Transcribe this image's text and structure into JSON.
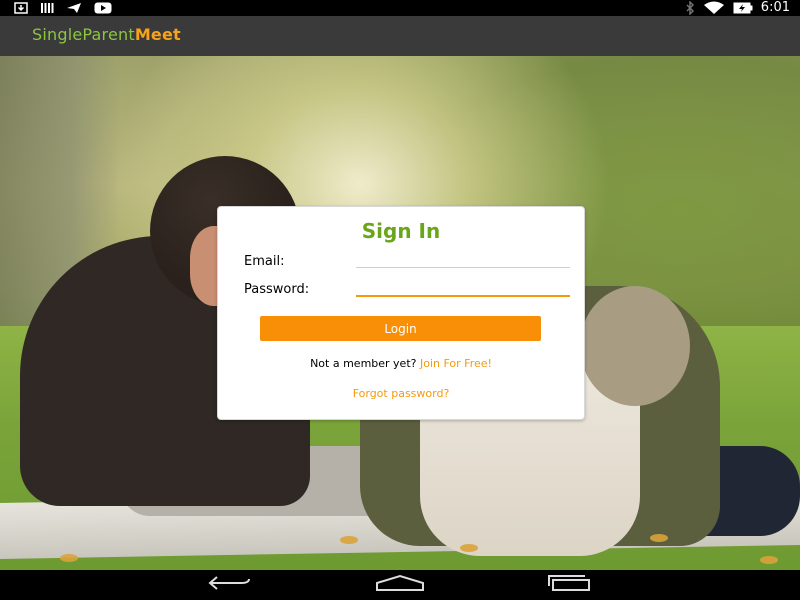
{
  "status_bar": {
    "left_icons": [
      "download-icon",
      "signal-bars-icon",
      "send-icon",
      "youtube-icon"
    ],
    "right_icons": [
      "bluetooth-icon",
      "wifi-icon",
      "battery-icon"
    ],
    "time": "6:01"
  },
  "app_bar": {
    "brand_part1": "SingleParent",
    "brand_part2": "Meet",
    "brand_color_1": "#8cc63f",
    "brand_color_2": "#f7a21b"
  },
  "signin": {
    "title": "Sign In",
    "email_label": "Email:",
    "email_value": "",
    "password_label": "Password:",
    "password_value": "",
    "login_label": "Login",
    "member_prompt": "Not a member yet?",
    "join_label": "Join For Free!",
    "forgot_label": "Forgot password?",
    "accent_color": "#f98f07",
    "title_color": "#6aa61a"
  },
  "nav_bar": {
    "buttons": [
      "back-icon",
      "home-icon",
      "recent-apps-icon"
    ]
  }
}
